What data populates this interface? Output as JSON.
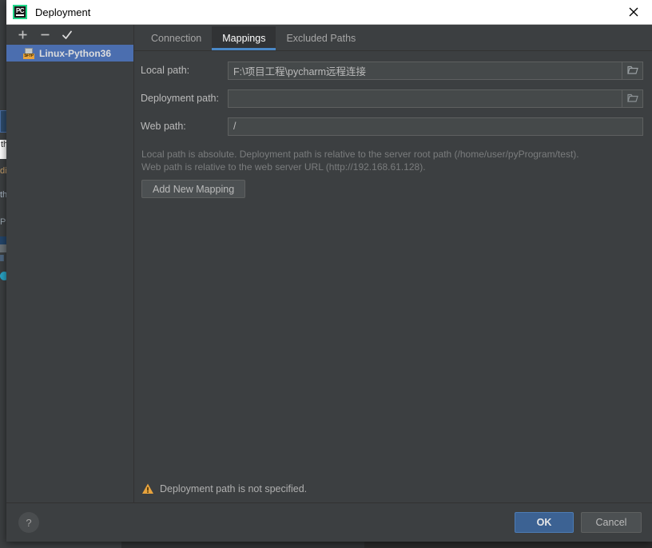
{
  "window": {
    "title": "Deployment",
    "app_icon": "pycharm-logo-icon",
    "close_icon": "close-icon"
  },
  "sidebar": {
    "toolbar": [
      {
        "name": "add-server-button",
        "icon": "plus-icon",
        "label": "+"
      },
      {
        "name": "remove-server-button",
        "icon": "minus-icon",
        "label": "−"
      },
      {
        "name": "set-default-server-button",
        "icon": "check-icon",
        "label": "✓"
      }
    ],
    "servers": [
      {
        "label": "Linux-Python36",
        "icon": "sftp-icon",
        "icon_text": "SFTP",
        "selected": true
      }
    ]
  },
  "tabs": [
    {
      "label": "Connection",
      "active": false
    },
    {
      "label": "Mappings",
      "active": true
    },
    {
      "label": "Excluded Paths",
      "active": false
    }
  ],
  "form": {
    "fields": [
      {
        "label": "Local path:",
        "value": "F:\\项目工程\\pycharm远程连接",
        "placeholder": "",
        "has_browse": true,
        "browse_icon": "folder-icon"
      },
      {
        "label": "Deployment path:",
        "value": "",
        "placeholder": "",
        "has_browse": true,
        "browse_icon": "folder-icon"
      },
      {
        "label": "Web path:",
        "value": "/",
        "placeholder": "",
        "has_browse": false,
        "browse_icon": ""
      }
    ],
    "hint_line1": "Local path is absolute. Deployment path is relative to the server root path (/home/user/pyProgram/test).",
    "hint_line2": "Web path is relative to the web server URL (http://192.168.61.128).",
    "add_mapping_label": "Add New Mapping"
  },
  "status": {
    "icon": "warning-triangle-icon",
    "message": "Deployment path is not specified."
  },
  "footer": {
    "help_label": "?",
    "ok_label": "OK",
    "cancel_label": "Cancel"
  },
  "colors": {
    "accent_blue": "#4a88c7",
    "selection_blue": "#4b6eaf",
    "ok_button_blue": "#3c6293",
    "warning_orange": "#e8a33d",
    "dialog_bg": "#3c3f41",
    "field_bg": "#45494a"
  },
  "background": {
    "fragments": [
      "th",
      "di",
      "th",
      "P",
      "ll"
    ]
  }
}
